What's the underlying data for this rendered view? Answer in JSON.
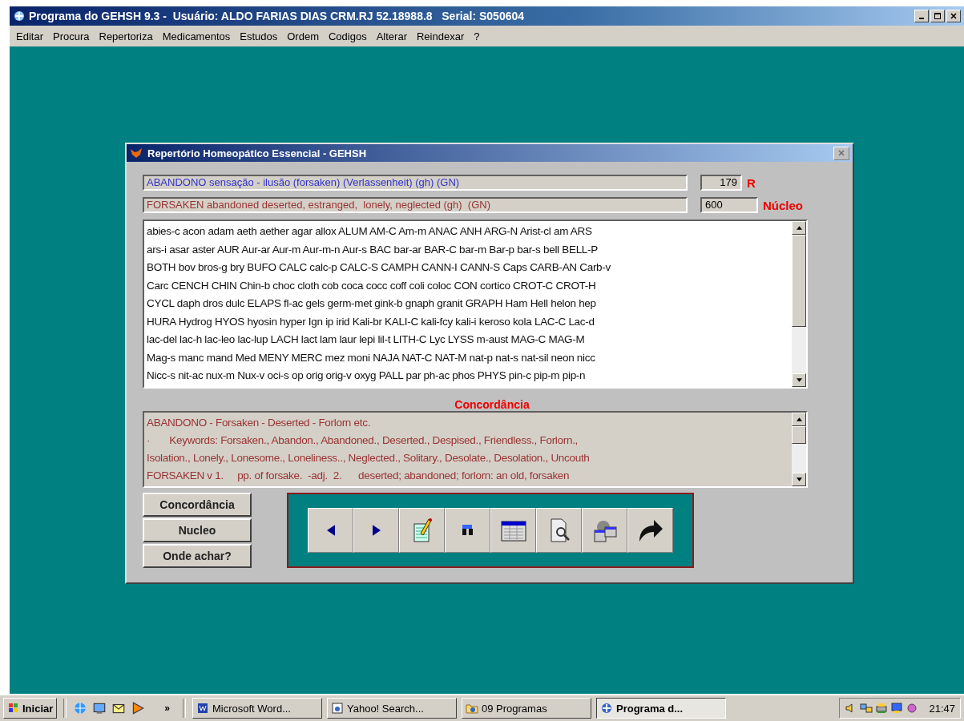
{
  "window": {
    "title": "Programa do GEHSH 9.3 -  Usuário: ALDO FARIAS DIAS CRM.RJ 52.18988.8   Serial: S050604"
  },
  "menu": [
    "Editar",
    "Procura",
    "Repertoriza",
    "Medicamentos",
    "Estudos",
    "Ordem",
    "Codigos",
    "Alterar",
    "Reindexar",
    "?"
  ],
  "dialog": {
    "title": "Repertório Homeopático Essencial - GEHSH",
    "fields": [
      {
        "value": "ABANDONO sensação - ilusão (forsaken) (Verlassenheit) (gh) (GN)",
        "color": "#3333cc",
        "count": "179",
        "label": "R"
      },
      {
        "value": "FORSAKEN abandoned deserted, estranged,  lonely, neglected (gh)  (GN)",
        "color": "#993333",
        "count": "600",
        "label": "Núcleo"
      }
    ],
    "remedies": [
      "abies-c acon adam aeth aether agar allox ALUM AM-C Am-m ANAC ANH ARG-N Arist-cl am ARS",
      "ars-i asar aster AUR Aur-ar Aur-m Aur-m-n Aur-s BAC bar-ar BAR-C bar-m Bar-p bar-s bell BELL-P",
      "BOTH bov bros-g bry BUFO CALC calc-p CALC-S CAMPH CANN-I CANN-S Caps CARB-AN Carb-v",
      "Carc CENCH CHIN Chin-b choc cloth cob coca cocc coff coli coloc CON cortico CROT-C CROT-H",
      "CYCL daph dros dulc ELAPS fl-ac gels germ-met gink-b gnaph granit GRAPH Ham Hell helon hep",
      "HURA Hydrog HYOS hyosin hyper Ign ip irid Kali-br KALI-C kali-fcy kali-i keroso kola LAC-C Lac-d",
      "lac-del lac-h lac-leo lac-lup LACH lact lam laur lepi lil-t LITH-C Lyc LYSS m-aust MAG-C MAG-M",
      "Mag-s manc mand Med MENY MERC mez moni NAJA NAT-C NAT-M nat-p nat-s nat-sil neon nicc",
      "Nicc-s nit-ac nux-m Nux-v oci-s op orig orig-v oxyg PALL par ph-ac phos PHYS pin-c pip-m pip-n"
    ],
    "concordance_title": "Concordância",
    "concordance": [
      "ABANDONO - Forsaken - Deserted - Forlorn etc.",
      "·       Keywords: Forsaken., Abandon., Abandoned., Deserted., Despised., Friendless., Forlorn.,",
      "Isolation., Lonely., Lonesome., Loneliness.., Neglected., Solitary., Desolate., Desolation., Uncouth",
      "FORSAKEN v 1.     pp. of forsake.  -adj.  2.      deserted; abandoned; forlorn: an old, forsaken"
    ],
    "buttons": [
      "Concordância",
      "Nucleo",
      "Onde achar?"
    ],
    "toolbar": [
      {
        "kind": "left"
      },
      {
        "kind": "right"
      },
      {
        "kind": "notepad"
      },
      {
        "kind": "binoculars"
      },
      {
        "kind": "table"
      },
      {
        "kind": "preview"
      },
      {
        "kind": "windows"
      },
      {
        "kind": "arrow"
      }
    ]
  },
  "taskbar": {
    "start": "Iniciar",
    "quick_launch": [
      {
        "kind": "globe"
      },
      {
        "kind": "desktop"
      },
      {
        "kind": "mail"
      },
      {
        "kind": "play"
      }
    ],
    "more": "»",
    "tasks": [
      {
        "label": "Microsoft Word...",
        "kind": "word",
        "selected": false
      },
      {
        "label": "Yahoo! Search...",
        "kind": "browser",
        "selected": false
      },
      {
        "label": "09 Programas",
        "kind": "folder",
        "selected": false
      },
      {
        "label": "Programa d...",
        "kind": "app",
        "selected": true
      }
    ],
    "tray": [
      {
        "kind": "speaker"
      },
      {
        "kind": "network"
      },
      {
        "kind": "printer"
      },
      {
        "kind": "display"
      },
      {
        "kind": "virus"
      }
    ],
    "clock": "21:47"
  }
}
